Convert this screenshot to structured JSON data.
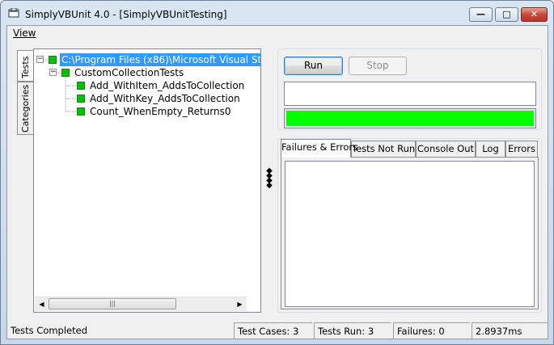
{
  "window": {
    "title": "SimplyVBUnit 4.0 - [SimplyVBUnitTesting]",
    "buttons": {
      "minimize": "—",
      "maximize": "□",
      "close": "✕"
    }
  },
  "menu": {
    "view": "View"
  },
  "side_tabs": {
    "tests": "Tests",
    "categories": "Categories"
  },
  "tree": {
    "root": "C:\\Program Files (x86)\\Microsoft Visual Studi",
    "fixture": "CustomCollectionTests",
    "tests": [
      "Add_WithItem_AddsToCollection",
      "Add_WithKey_AddsToCollection",
      "Count_WhenEmpty_Returns0"
    ],
    "status_color": "#00c000"
  },
  "controls": {
    "run": "Run",
    "stop": "Stop"
  },
  "progress": {
    "fraction": 1.0,
    "color": "#00ff00"
  },
  "result_tabs": [
    "Failures & Errors",
    "Tests Not Run",
    "Console Out",
    "Log",
    "Errors"
  ],
  "statusbar": {
    "status": "Tests Completed",
    "test_cases": "Test Cases: 3",
    "tests_run": "Tests Run: 3",
    "failures": "Failures: 0",
    "time": "2.8937ms"
  }
}
